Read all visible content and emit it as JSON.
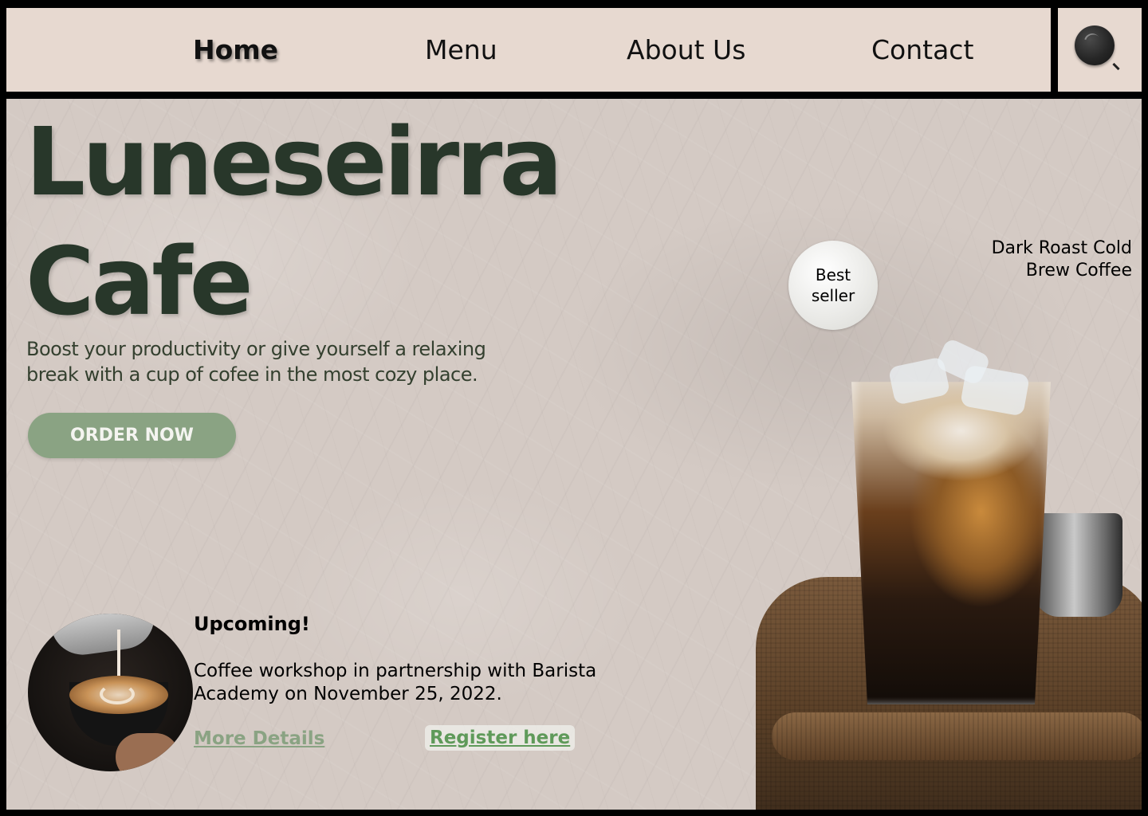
{
  "nav": {
    "items": [
      {
        "label": "Home",
        "active": true
      },
      {
        "label": "Menu",
        "active": false
      },
      {
        "label": "About Us",
        "active": false
      },
      {
        "label": "Contact",
        "active": false
      }
    ],
    "search_icon": "search-icon"
  },
  "hero": {
    "title_line1": "Luneseirra",
    "title_line2": "Cafe",
    "tagline": "Boost your productivity or give yourself a relaxing break with a cup of cofee in the most cozy place.",
    "cta_label": "ORDER NOW"
  },
  "upcoming": {
    "heading": "Upcoming!",
    "text": "Coffee workshop in partnership with Barista Academy on November 25, 2022.",
    "more_label": "More Details",
    "register_label": "Register here"
  },
  "featured": {
    "badge": "Best seller",
    "name": "Dark Roast Cold Brew Coffee"
  },
  "colors": {
    "nav_bg": "#e7d9d0",
    "title": "#28372a",
    "accent_green": "#8aa383",
    "link_green": "#5f9a5a",
    "frame": "#000000"
  }
}
